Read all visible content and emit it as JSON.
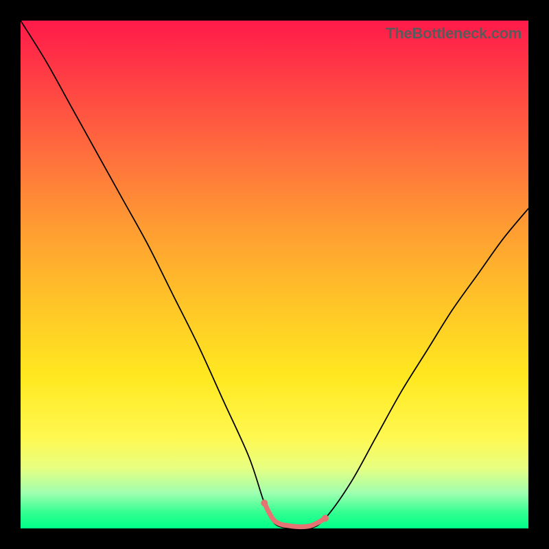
{
  "watermark": "TheBottleneck.com",
  "chart_data": {
    "type": "line",
    "title": "",
    "xlabel": "",
    "ylabel": "",
    "x_range": [
      0,
      100
    ],
    "y_range": [
      0,
      100
    ],
    "series": [
      {
        "name": "bottleneck-curve",
        "x": [
          0,
          5,
          10,
          15,
          20,
          25,
          30,
          35,
          40,
          45,
          48,
          50,
          53,
          57,
          60,
          65,
          70,
          75,
          80,
          85,
          90,
          95,
          100
        ],
        "y": [
          100,
          92,
          83,
          74,
          65,
          56,
          46,
          36,
          25,
          14,
          5,
          1,
          0,
          0,
          2,
          9,
          18,
          27,
          35,
          43,
          50,
          57,
          63
        ]
      }
    ],
    "highlight_segment": {
      "name": "optimal-flat-region",
      "x": [
        48,
        50,
        53,
        57,
        60
      ],
      "y": [
        5,
        1.5,
        0.5,
        0.5,
        2
      ]
    },
    "background_gradient": {
      "top": "#ff1a4a",
      "mid": "#ffd028",
      "bottom": "#00ff88"
    }
  }
}
